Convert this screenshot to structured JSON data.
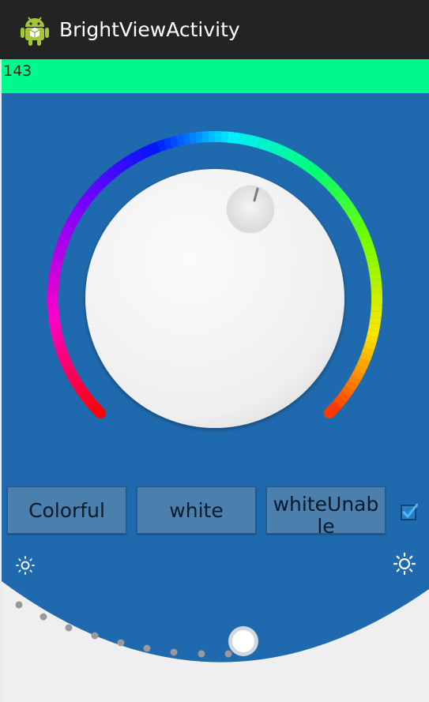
{
  "app": {
    "title": "BrightViewActivity",
    "icon": "android-robot-icon"
  },
  "value_readout": "143",
  "colors": {
    "title_bar": "#232323",
    "value_bar": "#00f98c",
    "main_bg": "#1f6aae",
    "button_bg": "#4b7fae",
    "bottom_panel": "#efefef"
  },
  "modes": {
    "colorful_label": "Colorful",
    "white_label": "white",
    "white_unable_label": "whiteUnable",
    "enabled_checked": true
  },
  "brightness": {
    "min_icon": "sun-small-icon",
    "max_icon": "sun-large-icon",
    "slider_icon": "slider-thumb"
  }
}
